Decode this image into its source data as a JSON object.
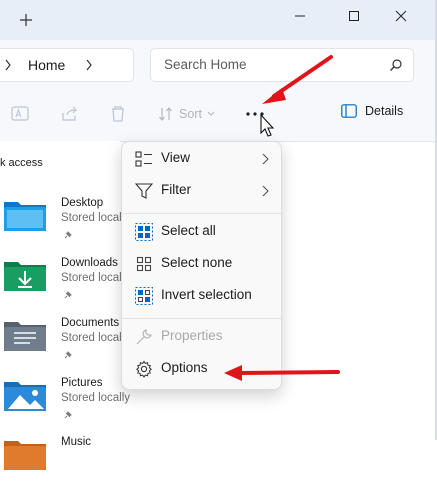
{
  "titlebar": {
    "new_tab_icon": "plus-icon",
    "minimize_icon": "minimize-icon",
    "maximize_icon": "maximize-icon",
    "close_icon": "close-icon"
  },
  "address": {
    "crumb": "Home",
    "search_placeholder": "Search Home"
  },
  "toolbar": {
    "sort_label": "Sort",
    "details_label": "Details"
  },
  "nav": {
    "header": "k access",
    "items": [
      {
        "name": "Desktop",
        "sub": "Stored locall",
        "icon": "desktop-folder-icon",
        "color": "#1f9ee6"
      },
      {
        "name": "Downloads",
        "sub": "Stored locall",
        "icon": "downloads-folder-icon",
        "color": "#1a9d62"
      },
      {
        "name": "Documents",
        "sub": "Stored locall",
        "icon": "documents-folder-icon",
        "color": "#6f7d8d"
      },
      {
        "name": "Pictures",
        "sub": "Stored locally",
        "icon": "pictures-folder-icon",
        "color": "#2b8ad9"
      },
      {
        "name": "Music",
        "sub": "",
        "icon": "music-folder-icon",
        "color": "#e07a2d"
      }
    ]
  },
  "menu": {
    "items": [
      {
        "label": "View",
        "icon": "view-icon",
        "submenu": true
      },
      {
        "label": "Filter",
        "icon": "filter-icon",
        "submenu": true
      },
      {
        "label": "Select all",
        "icon": "select-all-icon"
      },
      {
        "label": "Select none",
        "icon": "select-none-icon"
      },
      {
        "label": "Invert selection",
        "icon": "invert-selection-icon"
      },
      {
        "label": "Properties",
        "icon": "properties-icon",
        "disabled": true
      },
      {
        "label": "Options",
        "icon": "gear-icon"
      }
    ]
  },
  "colors": {
    "accent": "#0067c0",
    "annotation_arrow": "#e0141b"
  }
}
